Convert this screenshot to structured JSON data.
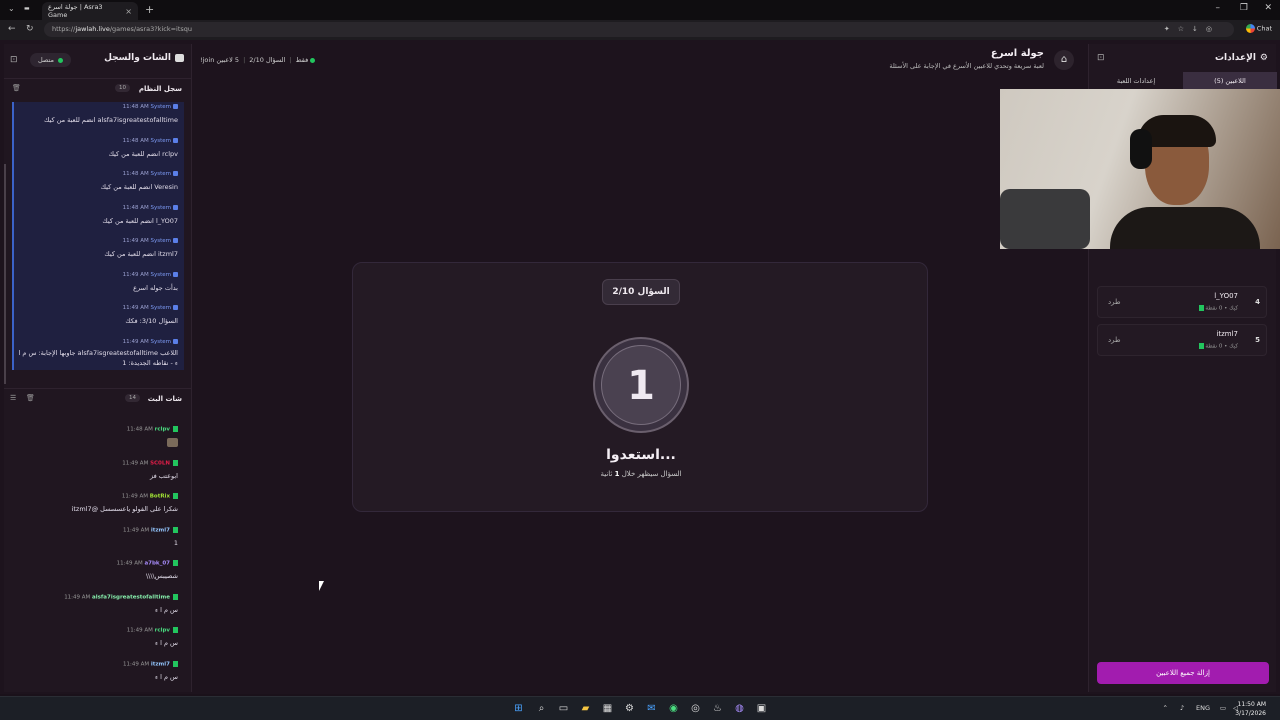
{
  "browser": {
    "tab_title": "جولة اسرع | Asra3 Game",
    "url_prefix": "https://",
    "url_domain": "jawlah.live",
    "url_path": "/games/asra3?kick=itsqu",
    "chat_button": "Chat"
  },
  "left_panel": {
    "title": "الشات والسجل",
    "status": "متصل",
    "system_log": {
      "title": "سجل النظام",
      "count": "10",
      "messages": [
        {
          "time": "11:48 AM",
          "author": "System",
          "text": "alsfa7isgreatestofalltime انضم للعبة من كيك"
        },
        {
          "time": "11:48 AM",
          "author": "System",
          "text": "rclpv انضم للعبة من كيك"
        },
        {
          "time": "11:48 AM",
          "author": "System",
          "text": "Veresin انضم للعبة من كيك"
        },
        {
          "time": "11:48 AM",
          "author": "System",
          "text": "l_YO07 انضم للعبة من كيك"
        },
        {
          "time": "11:49 AM",
          "author": "System",
          "text": "itzml7 انضم للعبة من كيك"
        },
        {
          "time": "11:49 AM",
          "author": "System",
          "text": "بدأت جوله اسرع"
        },
        {
          "time": "11:49 AM",
          "author": "System",
          "text": "السؤال 3/10: فكك"
        },
        {
          "time": "11:49 AM",
          "author": "System",
          "text": "اللاعب alsfa7isgreatestofalltime جاوبها الإجابة: س م ا ء - نقاطه الجديدة: 1"
        }
      ]
    },
    "stream_chat": {
      "title": "شات البث",
      "count": "14",
      "messages": [
        {
          "time": "11:48 AM",
          "user": "rclpv",
          "color": "#4ade80",
          "text": ""
        },
        {
          "time": "11:49 AM",
          "user": "SC0LN",
          "color": "#e11d48",
          "text": "ابوعتب فز"
        },
        {
          "time": "11:49 AM",
          "user": "BotRix",
          "color": "#a3e635",
          "text": "شكرا على الفولو ياعسسسل @itzml7"
        },
        {
          "time": "11:49 AM",
          "user": "itzml7",
          "color": "#93c5fd",
          "text": "1"
        },
        {
          "time": "11:49 AM",
          "user": "a7bk_07",
          "color": "#a78bfa",
          "text": "شصيبس\\\\\\\\"
        },
        {
          "time": "11:49 AM",
          "user": "alsfa7isgreatestofalltime",
          "color": "#86efac",
          "text": "س م ا ء"
        },
        {
          "time": "11:49 AM",
          "user": "rclpv",
          "color": "#4ade80",
          "text": "س م ا ء"
        },
        {
          "time": "11:49 AM",
          "user": "itzml7",
          "color": "#93c5fd",
          "text": "س م ا ء"
        }
      ]
    }
  },
  "header": {
    "title": "جولة اسرع",
    "subtitle": "لعبة سريعة وتحدي للاعبين الأسرع في الإجابة على الأسئلة",
    "players_count": "5 لاعبين",
    "question_progress": "السؤال 2/10",
    "join_note": "!join فقط"
  },
  "card": {
    "question_badge": "السؤال 2/10",
    "countdown": "1",
    "ready_text": "استعدوا...",
    "soon_prefix": "السؤال سيظهر خلال",
    "soon_seconds": "1",
    "soon_suffix": "ثانية"
  },
  "right_panel": {
    "title": "الإعدادات",
    "tabs": [
      "إعدادات اللعبة",
      "اللاعبين (5)"
    ],
    "active_tab": 1,
    "players": [
      {
        "rank": "4",
        "name": "l_YO07",
        "meta": "كيك • 0 نقطة",
        "kick": "طرد"
      },
      {
        "rank": "5",
        "name": "itzml7",
        "meta": "كيك • 0 نقطة",
        "kick": "طرد"
      }
    ],
    "remove_all": "إزالة جميع اللاعبين"
  },
  "taskbar": {
    "lang": "ENG",
    "time": "11:50 AM",
    "date": "3/17/2026"
  },
  "colors": {
    "accent_purple": "#a21caf",
    "online_green": "#22c55e",
    "system_blue": "#3b62c8"
  }
}
